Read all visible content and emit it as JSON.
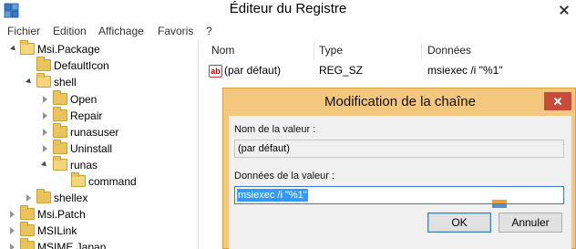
{
  "window": {
    "title": "Éditeur du Registre"
  },
  "menu": [
    "Fichier",
    "Edition",
    "Affichage",
    "Favoris",
    "?"
  ],
  "tree": [
    {
      "label": "Msi.Package",
      "level": 1,
      "expanded": true
    },
    {
      "label": "DefaultIcon",
      "level": 2,
      "expanded": false,
      "no_arrow": true
    },
    {
      "label": "shell",
      "level": 2,
      "expanded": true
    },
    {
      "label": "Open",
      "level": 3,
      "expanded": false
    },
    {
      "label": "Repair",
      "level": 3,
      "expanded": false
    },
    {
      "label": "runasuser",
      "level": 3,
      "expanded": false
    },
    {
      "label": "Uninstall",
      "level": 3,
      "expanded": false
    },
    {
      "label": "runas",
      "level": 3,
      "expanded": true
    },
    {
      "label": "command",
      "level": 4,
      "selected": true,
      "no_arrow": true
    },
    {
      "label": "shellex",
      "level": 2,
      "expanded": false
    },
    {
      "label": "Msi.Patch",
      "level": 1,
      "expanded": false
    },
    {
      "label": "MSILink",
      "level": 1,
      "expanded": false
    },
    {
      "label": "MSIME.Japan",
      "level": 1,
      "expanded": false
    }
  ],
  "columns": {
    "name": "Nom",
    "type": "Type",
    "data": "Données"
  },
  "values": [
    {
      "name": "(par défaut)",
      "type": "REG_SZ",
      "data": "msiexec /i \"%1\""
    }
  ],
  "dialog": {
    "title": "Modification de la chaîne",
    "value_name_label": "Nom de la valeur :",
    "value_name": "(par défaut)",
    "value_data_label": "Données de la valeur :",
    "value_data": "msiexec /i \"%1\"",
    "ok_label": "OK",
    "cancel_label": "Annuler"
  },
  "colors": {
    "dialog_frame": "#f4c77f",
    "selection": "#3399ff",
    "close_button": "#c94b3c"
  }
}
